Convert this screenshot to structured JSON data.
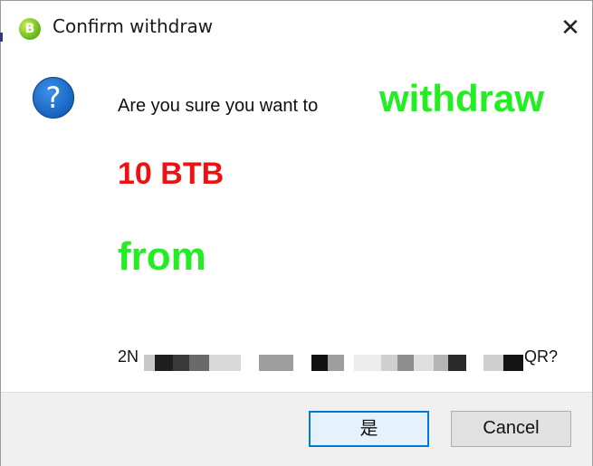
{
  "window": {
    "title": "Confirm withdraw",
    "close_glyph": "✕",
    "app_icon_glyph": "B"
  },
  "message": {
    "icon_glyph": "?",
    "prefix": "Are you sure you want to",
    "action": "withdraw",
    "amount": "10 BTB",
    "from": "from",
    "address_start": "2N",
    "address_end": "QR?"
  },
  "buttons": {
    "yes": "是",
    "cancel": "Cancel"
  },
  "colors": {
    "action": "#22ee22",
    "amount": "#ee1111",
    "accent": "#0078d7"
  },
  "icons": {
    "app": "bitcoin-app-icon",
    "question": "question-icon",
    "close": "close-icon"
  }
}
